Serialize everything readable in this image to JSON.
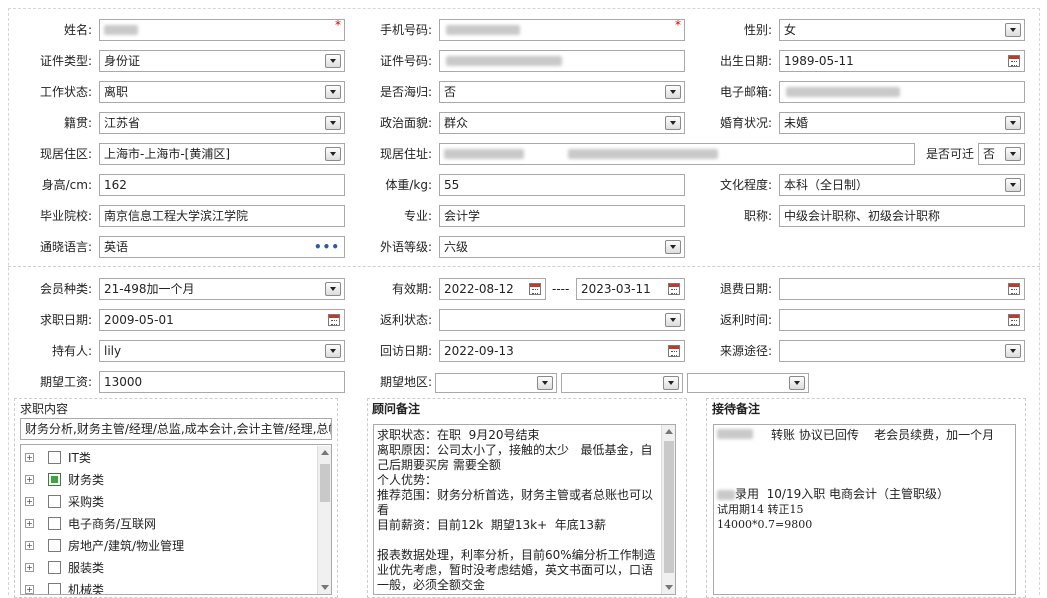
{
  "personal": {
    "name_label": "姓名:",
    "phone_label": "手机号码:",
    "gender_label": "性别:",
    "gender_value": "女",
    "id_type_label": "证件类型:",
    "id_type_value": "身份证",
    "id_no_label": "证件号码:",
    "birth_label": "出生日期:",
    "birth_value": "1989-05-11",
    "work_status_label": "工作状态:",
    "work_status_value": "离职",
    "overseas_label": "是否海归:",
    "overseas_value": "否",
    "email_label": "电子邮箱:",
    "native_label": "籍贯:",
    "native_value": "江苏省",
    "political_label": "政治面貌:",
    "political_value": "群众",
    "marital_label": "婚育状况:",
    "marital_value": "未婚",
    "residence_label": "现居住区:",
    "residence_value": "上海市-上海市-[黄浦区]",
    "address_label": "现居住址:",
    "movable_label": "是否可迁",
    "movable_value": "否",
    "height_label": "身高/cm:",
    "height_value": "162",
    "weight_label": "体重/kg:",
    "weight_value": "55",
    "education_label": "文化程度:",
    "education_value": "本科（全日制）",
    "school_label": "毕业院校:",
    "school_value": "南京信息工程大学滨江学院",
    "major_label": "专业:",
    "major_value": "会计学",
    "title_label": "职称:",
    "title_value": "中级会计职称、初级会计职称",
    "language_label": "通晓语言:",
    "language_value": "英语",
    "lang_level_label": "外语等级:",
    "lang_level_value": "六级"
  },
  "membership": {
    "member_type_label": "会员种类:",
    "member_type_value": "21-498加一个月",
    "valid_label": "有效期:",
    "valid_from": "2022-08-12",
    "valid_sep": "----",
    "valid_to": "2023-03-11",
    "refund_label": "退费日期:",
    "job_date_label": "求职日期:",
    "job_date_value": "2009-05-01",
    "rebate_status_label": "返利状态:",
    "rebate_time_label": "返利时间:",
    "holder_label": "持有人:",
    "holder_value": "lily",
    "revisit_label": "回访日期:",
    "revisit_value": "2022-09-13",
    "source_label": "来源途径:",
    "salary_label": "期望工资:",
    "salary_value": "13000",
    "region_label": "期望地区:"
  },
  "job_content": {
    "title": "求职内容",
    "summary": "财务分析,财务主管/经理/总监,成本会计,会计主管/经理,总帐",
    "tree": [
      {
        "label": "IT类",
        "checked": false
      },
      {
        "label": "财务类",
        "checked": true
      },
      {
        "label": "采购类",
        "checked": false
      },
      {
        "label": "电子商务/互联网",
        "checked": false
      },
      {
        "label": "房地产/建筑/物业管理",
        "checked": false
      },
      {
        "label": "服装类",
        "checked": false
      },
      {
        "label": "机械类",
        "checked": false
      }
    ]
  },
  "consultant_note": {
    "title": "顾问备注",
    "text": "求职状态：在职  9月20号结束\n离职原因：公司太小了，接触的太少   最低基金，自己后期要买房 需要全额\n个人优势：\n推荐范围：财务分析首选，财务主管或者总账也可以看\n目前薪资：目前12k  期望13k+  年底13薪\n\n报表数据处理，利率分析，目前60%编分析工作制造业优先考虑，暂时没考虑结婚，英文书面可以，口语一般，必须全额交金"
  },
  "reception_note": {
    "title": "接待备注",
    "line1": "转账 协议已回传    老会员续费，加一个月",
    "line2": "录用  10/19入职 电商会计（主管职级）",
    "line3": "试用期14 转正15",
    "line4": "14000*0.7=9800"
  },
  "colors": {
    "accent_check": "#3aa83a",
    "required": "#dd0000",
    "border": "#a9a9a9"
  }
}
